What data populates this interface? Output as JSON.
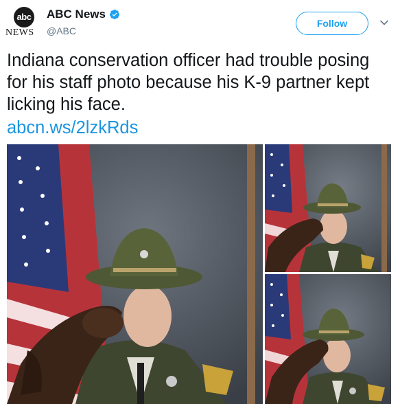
{
  "account": {
    "display_name": "ABC News",
    "handle": "@ABC",
    "logo_text": "abc",
    "logo_subtext": "NEWS",
    "verified": true
  },
  "actions": {
    "follow_label": "Follow",
    "menu_icon": "chevron-down-icon"
  },
  "tweet": {
    "text": "Indiana conservation officer had trouble posing for his staff photo because his K-9 partner kept licking his face.",
    "link": "abcn.ws/2lzkRds"
  },
  "media": {
    "count": 3,
    "items": [
      {
        "name": "main-photo",
        "subject": "officer with dog licking his face"
      },
      {
        "name": "top-right-photo",
        "subject": "officer smiling, eyes closed, dog licking"
      },
      {
        "name": "bottom-right-photo",
        "subject": "officer with dog leaning in"
      }
    ]
  },
  "colors": {
    "accent": "#1da1f2",
    "link": "#1b95e0",
    "text": "#14171a",
    "muted": "#657786"
  }
}
